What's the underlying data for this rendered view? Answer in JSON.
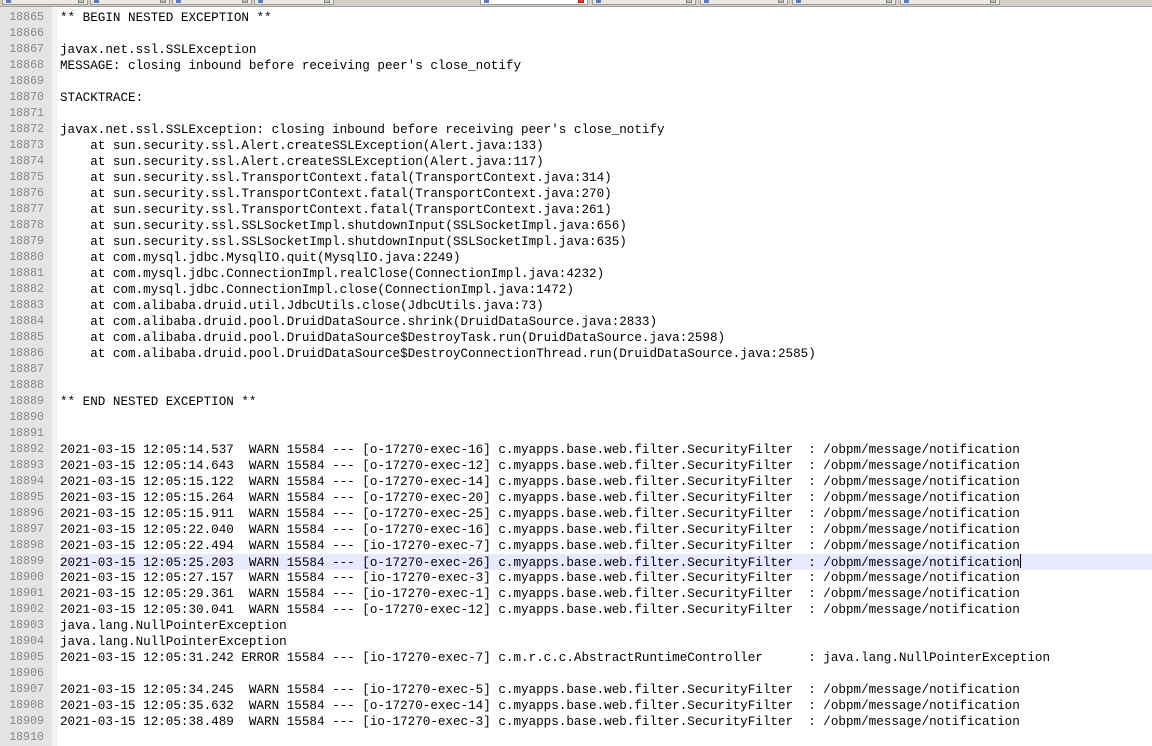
{
  "tabs": [
    {
      "label": "",
      "active": false
    },
    {
      "label": "",
      "active": false
    },
    {
      "label": "",
      "active": false
    },
    {
      "label": "",
      "active": false
    },
    {
      "label": "",
      "active": true
    },
    {
      "label": "",
      "active": false
    },
    {
      "label": "",
      "active": false
    },
    {
      "label": "",
      "active": false
    },
    {
      "label": "",
      "active": false
    }
  ],
  "editor": {
    "current_line": 18899,
    "lines": [
      {
        "n": "18865",
        "text": "** BEGIN NESTED EXCEPTION **"
      },
      {
        "n": "18866",
        "text": ""
      },
      {
        "n": "18867",
        "text": "javax.net.ssl.SSLException"
      },
      {
        "n": "18868",
        "text": "MESSAGE: closing inbound before receiving peer's close_notify"
      },
      {
        "n": "18869",
        "text": ""
      },
      {
        "n": "18870",
        "text": "STACKTRACE:"
      },
      {
        "n": "18871",
        "text": ""
      },
      {
        "n": "18872",
        "text": "javax.net.ssl.SSLException: closing inbound before receiving peer's close_notify"
      },
      {
        "n": "18873",
        "text": "    at sun.security.ssl.Alert.createSSLException(Alert.java:133)"
      },
      {
        "n": "18874",
        "text": "    at sun.security.ssl.Alert.createSSLException(Alert.java:117)"
      },
      {
        "n": "18875",
        "text": "    at sun.security.ssl.TransportContext.fatal(TransportContext.java:314)"
      },
      {
        "n": "18876",
        "text": "    at sun.security.ssl.TransportContext.fatal(TransportContext.java:270)"
      },
      {
        "n": "18877",
        "text": "    at sun.security.ssl.TransportContext.fatal(TransportContext.java:261)"
      },
      {
        "n": "18878",
        "text": "    at sun.security.ssl.SSLSocketImpl.shutdownInput(SSLSocketImpl.java:656)"
      },
      {
        "n": "18879",
        "text": "    at sun.security.ssl.SSLSocketImpl.shutdownInput(SSLSocketImpl.java:635)"
      },
      {
        "n": "18880",
        "text": "    at com.mysql.jdbc.MysqlIO.quit(MysqlIO.java:2249)"
      },
      {
        "n": "18881",
        "text": "    at com.mysql.jdbc.ConnectionImpl.realClose(ConnectionImpl.java:4232)"
      },
      {
        "n": "18882",
        "text": "    at com.mysql.jdbc.ConnectionImpl.close(ConnectionImpl.java:1472)"
      },
      {
        "n": "18883",
        "text": "    at com.alibaba.druid.util.JdbcUtils.close(JdbcUtils.java:73)"
      },
      {
        "n": "18884",
        "text": "    at com.alibaba.druid.pool.DruidDataSource.shrink(DruidDataSource.java:2833)"
      },
      {
        "n": "18885",
        "text": "    at com.alibaba.druid.pool.DruidDataSource$DestroyTask.run(DruidDataSource.java:2598)"
      },
      {
        "n": "18886",
        "text": "    at com.alibaba.druid.pool.DruidDataSource$DestroyConnectionThread.run(DruidDataSource.java:2585)"
      },
      {
        "n": "18887",
        "text": ""
      },
      {
        "n": "18888",
        "text": ""
      },
      {
        "n": "18889",
        "text": "** END NESTED EXCEPTION **"
      },
      {
        "n": "18890",
        "text": ""
      },
      {
        "n": "18891",
        "text": ""
      },
      {
        "n": "18892",
        "text": "2021-03-15 12:05:14.537  WARN 15584 --- [o-17270-exec-16] c.myapps.base.web.filter.SecurityFilter  : /obpm/message/notification"
      },
      {
        "n": "18893",
        "text": "2021-03-15 12:05:14.643  WARN 15584 --- [o-17270-exec-12] c.myapps.base.web.filter.SecurityFilter  : /obpm/message/notification"
      },
      {
        "n": "18894",
        "text": "2021-03-15 12:05:15.122  WARN 15584 --- [o-17270-exec-14] c.myapps.base.web.filter.SecurityFilter  : /obpm/message/notification"
      },
      {
        "n": "18895",
        "text": "2021-03-15 12:05:15.264  WARN 15584 --- [o-17270-exec-20] c.myapps.base.web.filter.SecurityFilter  : /obpm/message/notification"
      },
      {
        "n": "18896",
        "text": "2021-03-15 12:05:15.911  WARN 15584 --- [o-17270-exec-25] c.myapps.base.web.filter.SecurityFilter  : /obpm/message/notification"
      },
      {
        "n": "18897",
        "text": "2021-03-15 12:05:22.040  WARN 15584 --- [o-17270-exec-16] c.myapps.base.web.filter.SecurityFilter  : /obpm/message/notification"
      },
      {
        "n": "18898",
        "text": "2021-03-15 12:05:22.494  WARN 15584 --- [io-17270-exec-7] c.myapps.base.web.filter.SecurityFilter  : /obpm/message/notification"
      },
      {
        "n": "18899",
        "text": "2021-03-15 12:05:25.203  WARN 15584 --- [o-17270-exec-26] c.myapps.base.web.filter.SecurityFilter  : /obpm/message/notification"
      },
      {
        "n": "18900",
        "text": "2021-03-15 12:05:27.157  WARN 15584 --- [io-17270-exec-3] c.myapps.base.web.filter.SecurityFilter  : /obpm/message/notification"
      },
      {
        "n": "18901",
        "text": "2021-03-15 12:05:29.361  WARN 15584 --- [io-17270-exec-1] c.myapps.base.web.filter.SecurityFilter  : /obpm/message/notification"
      },
      {
        "n": "18902",
        "text": "2021-03-15 12:05:30.041  WARN 15584 --- [o-17270-exec-12] c.myapps.base.web.filter.SecurityFilter  : /obpm/message/notification"
      },
      {
        "n": "18903",
        "text": "java.lang.NullPointerException"
      },
      {
        "n": "18904",
        "text": "java.lang.NullPointerException"
      },
      {
        "n": "18905",
        "text": "2021-03-15 12:05:31.242 ERROR 15584 --- [io-17270-exec-7] c.m.r.c.c.AbstractRuntimeController      : java.lang.NullPointerException"
      },
      {
        "n": "18906",
        "text": ""
      },
      {
        "n": "18907",
        "text": "2021-03-15 12:05:34.245  WARN 15584 --- [io-17270-exec-5] c.myapps.base.web.filter.SecurityFilter  : /obpm/message/notification"
      },
      {
        "n": "18908",
        "text": "2021-03-15 12:05:35.632  WARN 15584 --- [o-17270-exec-14] c.myapps.base.web.filter.SecurityFilter  : /obpm/message/notification"
      },
      {
        "n": "18909",
        "text": "2021-03-15 12:05:38.489  WARN 15584 --- [io-17270-exec-3] c.myapps.base.web.filter.SecurityFilter  : /obpm/message/notification"
      },
      {
        "n": "18910",
        "text": ""
      }
    ]
  }
}
